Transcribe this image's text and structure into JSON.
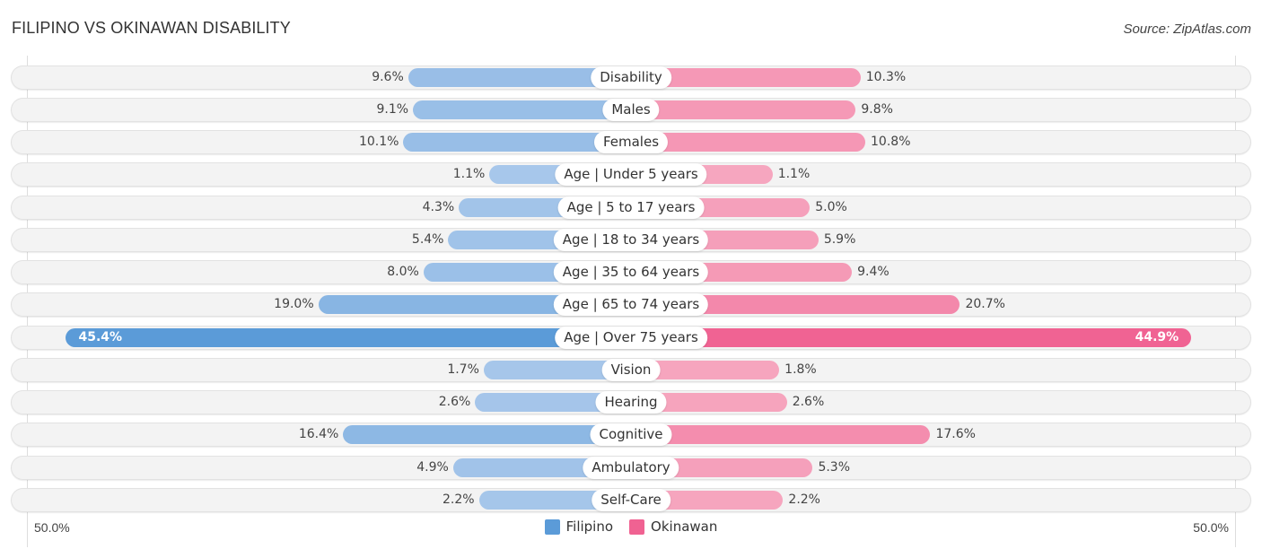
{
  "header": {
    "title": "FILIPINO VS OKINAWAN DISABILITY",
    "source": "Source: ZipAtlas.com"
  },
  "colors": {
    "filipino": "#5b9bd8",
    "filipino_light": "#a9c8eb",
    "okinawan": "#f06292",
    "okinawan_light": "#f6a8c0"
  },
  "chart_data": {
    "type": "bar",
    "orientation": "horizontal-diverging",
    "title": "FILIPINO VS OKINAWAN DISABILITY",
    "categories": [
      "Disability",
      "Males",
      "Females",
      "Age | Under 5 years",
      "Age | 5 to 17 years",
      "Age | 18 to 34 years",
      "Age | 35 to 64 years",
      "Age | 65 to 74 years",
      "Age | Over 75 years",
      "Vision",
      "Hearing",
      "Cognitive",
      "Ambulatory",
      "Self-Care"
    ],
    "series": [
      {
        "name": "Filipino",
        "side": "left",
        "values": [
          9.6,
          9.1,
          10.1,
          1.1,
          4.3,
          5.4,
          8.0,
          19.0,
          45.4,
          1.7,
          2.6,
          16.4,
          4.9,
          2.2
        ],
        "labels": [
          "9.6%",
          "9.1%",
          "10.1%",
          "1.1%",
          "4.3%",
          "5.4%",
          "8.0%",
          "19.0%",
          "45.4%",
          "1.7%",
          "2.6%",
          "16.4%",
          "4.9%",
          "2.2%"
        ]
      },
      {
        "name": "Okinawan",
        "side": "right",
        "values": [
          10.3,
          9.8,
          10.8,
          1.1,
          5.0,
          5.9,
          9.4,
          20.7,
          44.9,
          1.8,
          2.6,
          17.6,
          5.3,
          2.2
        ],
        "labels": [
          "10.3%",
          "9.8%",
          "10.8%",
          "1.1%",
          "5.0%",
          "5.9%",
          "9.4%",
          "20.7%",
          "44.9%",
          "1.8%",
          "2.6%",
          "17.6%",
          "5.3%",
          "2.2%"
        ]
      }
    ],
    "xlim": [
      -50,
      50
    ],
    "axis_labels": {
      "left": "50.0%",
      "right": "50.0%"
    },
    "unit": "%",
    "legend": {
      "position": "bottom-center",
      "entries": [
        "Filipino",
        "Okinawan"
      ]
    },
    "grid": false
  }
}
